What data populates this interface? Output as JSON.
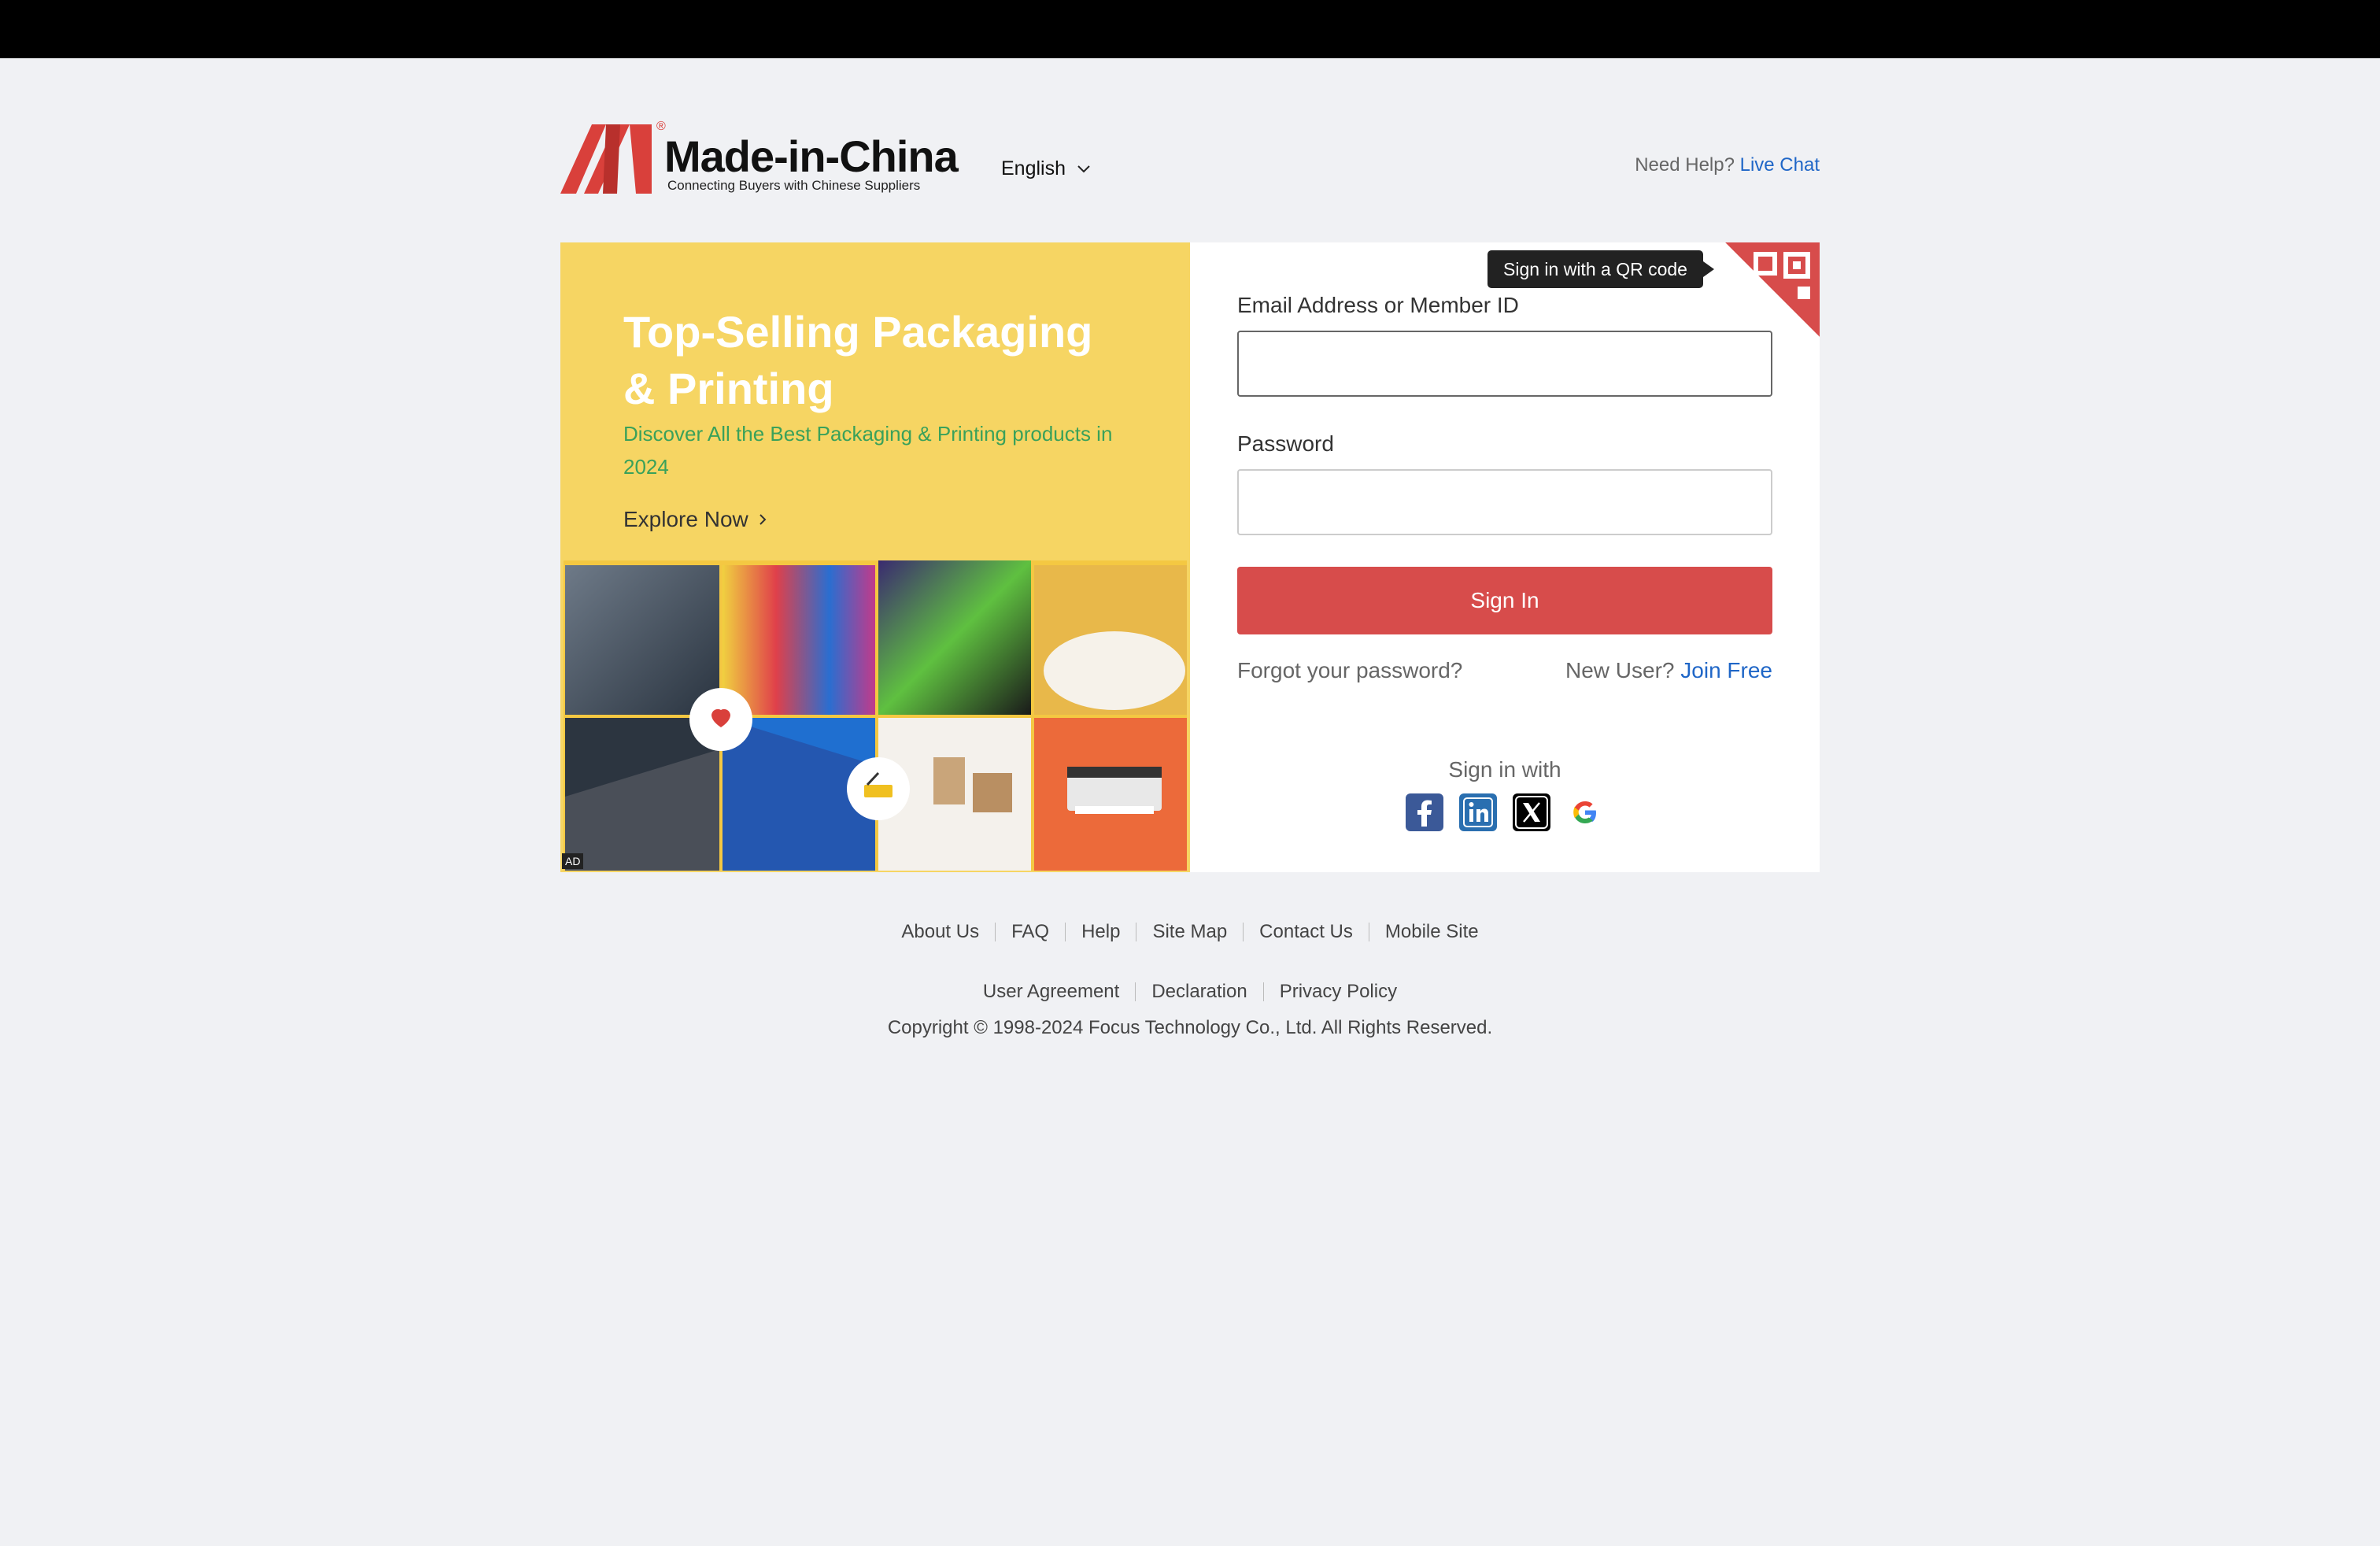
{
  "header": {
    "logo_name": "Made-in-China",
    "logo_tagline": "Connecting Buyers with Chinese Suppliers",
    "logo_reg": "®",
    "language": "English",
    "help_prefix": "Need Help?",
    "help_link": "Live Chat"
  },
  "ad": {
    "title": "Top-Selling Packaging & Printing",
    "subtitle": "Discover All the Best Packaging & Printing products in 2024",
    "cta": "Explore Now",
    "tag": "AD"
  },
  "form": {
    "qr_tooltip": "Sign in with a QR code",
    "email_label": "Email Address or Member ID",
    "email_value": "",
    "password_label": "Password",
    "password_value": "",
    "signin_button": "Sign In",
    "forgot_link": "Forgot your password?",
    "new_user_prefix": "New User?",
    "join_link": "Join Free",
    "signin_with": "Sign in with",
    "socials": [
      "facebook-icon",
      "linkedin-icon",
      "x-icon",
      "google-icon"
    ]
  },
  "footer": {
    "links_row1": [
      "About Us",
      "FAQ",
      "Help",
      "Site Map",
      "Contact Us",
      "Mobile Site"
    ],
    "links_row2": [
      "User Agreement",
      "Declaration",
      "Privacy Policy"
    ],
    "copyright": "Copyright © 1998-2024 Focus Technology Co., Ltd. All Rights Reserved."
  },
  "colors": {
    "brand_red": "#d74c4b",
    "link_blue": "#1f66c7",
    "ad_yellow": "#f6d563"
  }
}
